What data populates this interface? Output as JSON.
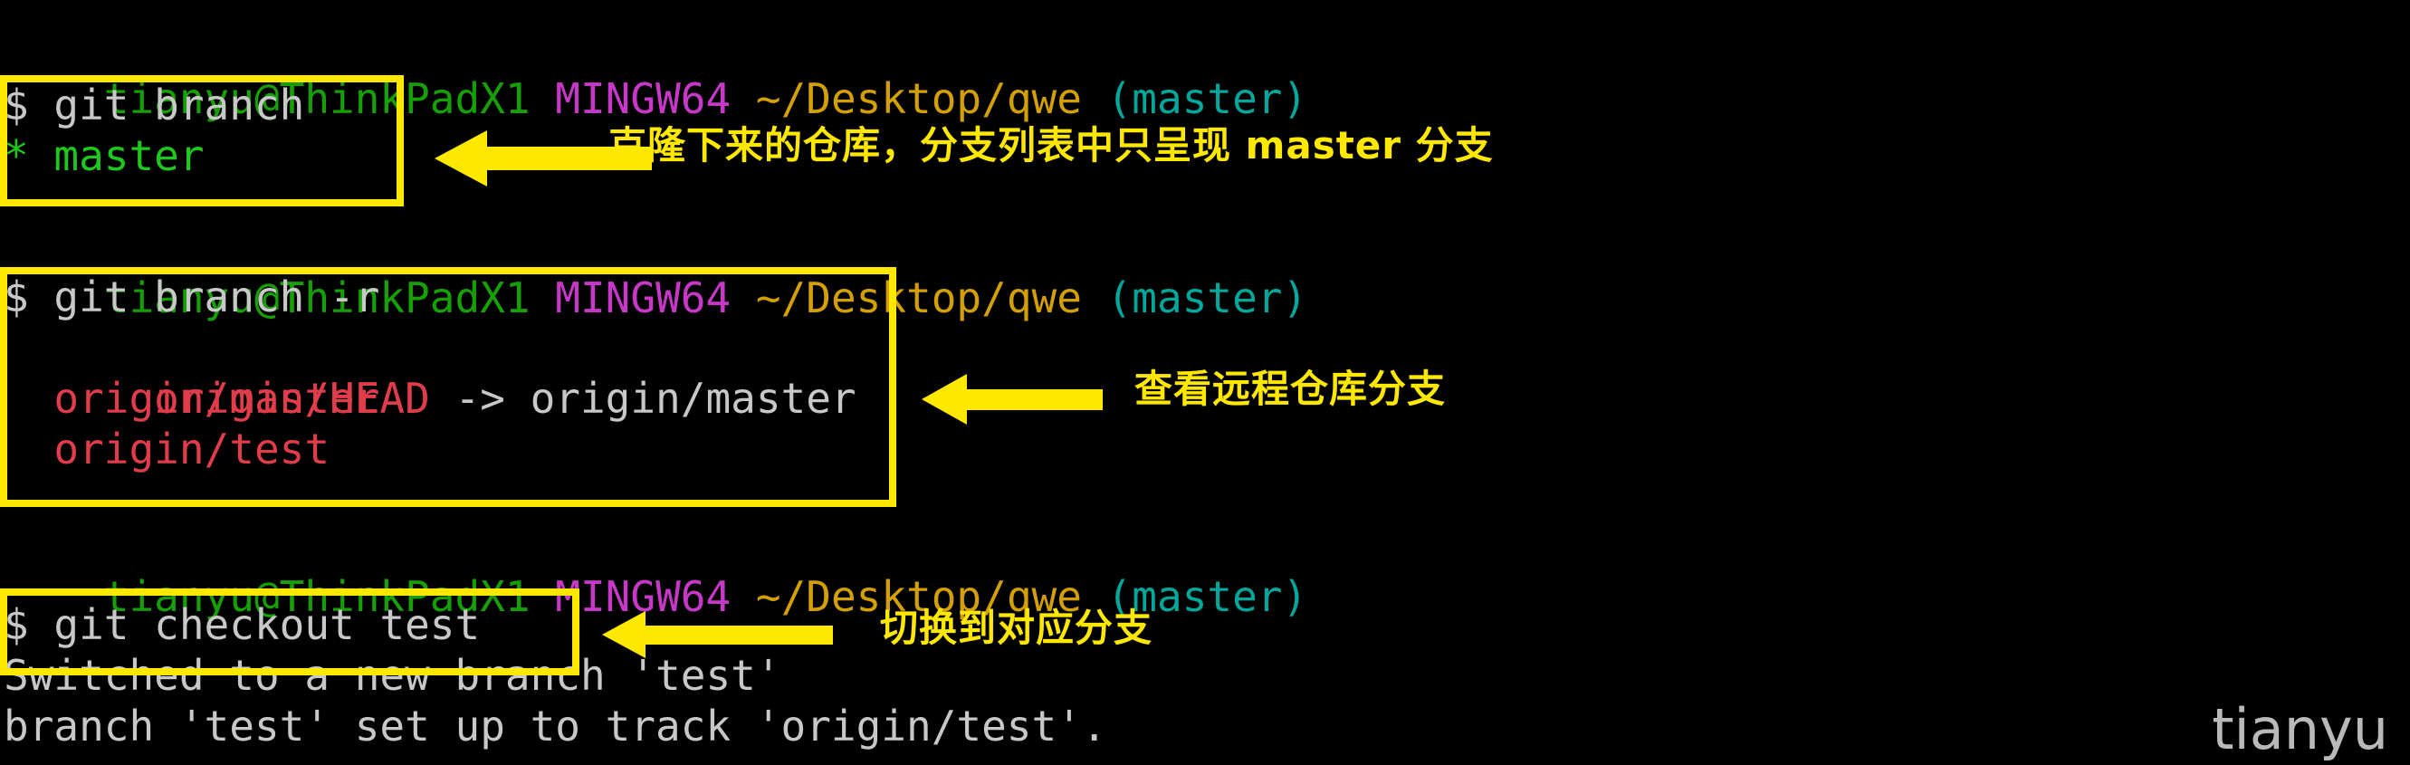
{
  "terminal": {
    "prompt": {
      "user": "tianyu@ThinkPadX1",
      "host": "MINGW64",
      "path": "~/Desktop/qwe",
      "branch": "(master)"
    },
    "blocks": [
      {
        "name": "git-branch-block",
        "command": "$ git branch",
        "output": [
          {
            "text": "* master",
            "color": "green"
          }
        ]
      },
      {
        "name": "git-branch-remote-block",
        "command": "$ git branch -r",
        "output": [
          {
            "text": "  origin/HEAD",
            "color": "red"
          },
          {
            "text": " -> origin/master",
            "color": "white"
          },
          {
            "text": "  origin/master",
            "color": "red"
          },
          {
            "text": "  origin/test",
            "color": "red"
          }
        ]
      },
      {
        "name": "git-checkout-block",
        "command": "$ git checkout test",
        "output": [
          {
            "text": "Switched to a new branch 'test'",
            "color": "white"
          },
          {
            "text": "branch 'test' set up to track 'origin/test'.",
            "color": "white"
          }
        ]
      }
    ]
  },
  "annotations": [
    {
      "name": "annotation-clone-branches",
      "text": "克隆下来的仓库，分支列表中只呈现 master 分支"
    },
    {
      "name": "annotation-view-remote-branches",
      "text": "查看远程仓库分支"
    },
    {
      "name": "annotation-switch-branch",
      "text": "切换到对应分支"
    }
  ],
  "watermark": {
    "text": "tianyu"
  },
  "colors": {
    "background": "#000000",
    "highlight": "#ffe800",
    "prompt_user": "#16a005",
    "prompt_host": "#c838c8",
    "prompt_path": "#d4a000",
    "prompt_branch": "#00a79a",
    "text_default": "#c8c8c8",
    "branch_local": "#1ec81e",
    "branch_remote": "#e03c4a",
    "watermark": "#b9b9b9"
  }
}
